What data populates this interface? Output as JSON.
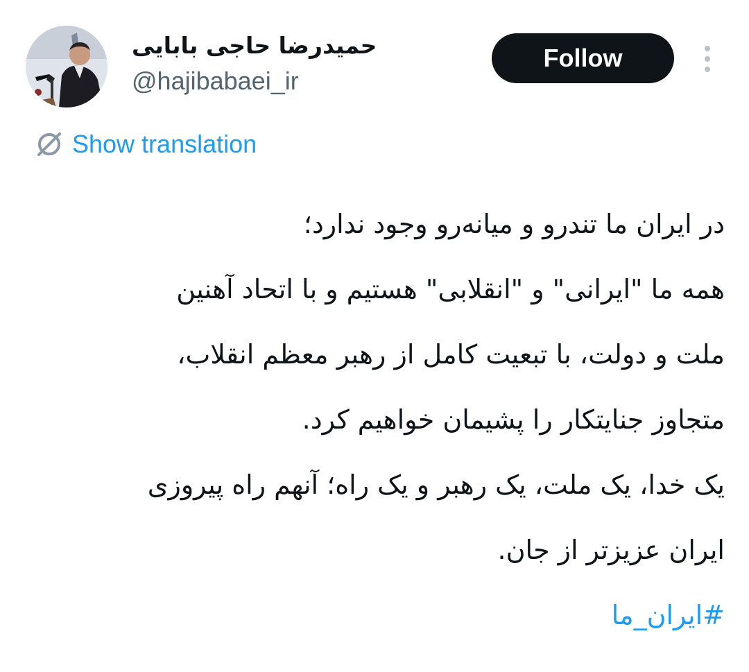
{
  "author": {
    "display_name": "حمیدرضا حاجی بابایی",
    "handle": "@hajibabaei_ir"
  },
  "actions": {
    "follow_label": "Follow",
    "more_icon": "more-vertical-icon"
  },
  "translation": {
    "label": "Show translation",
    "icon": "globe-icon"
  },
  "tweet": {
    "lines": [
      "در ایران ما تندرو و میانه‌رو وجود ندارد؛",
      "همه ما \"ایرانی\" و \"انقلابی\" هستیم و با اتحاد آهنین",
      "ملت و دولت، با تبعیت کامل از رهبر معظم انقلاب،",
      "متجاوز جنایتکار را پشیمان خواهیم کرد.",
      "یک خدا، یک ملت، یک رهبر و یک راه؛ آنهم راه پیروزی",
      "ایران عزیزتر از جان."
    ],
    "hashtag": "#ایران_ما"
  },
  "colors": {
    "accent": "#1d9bf0",
    "text": "#0f1419",
    "secondary_text": "#536471",
    "button_bg": "#0f1419",
    "button_text": "#ffffff"
  }
}
